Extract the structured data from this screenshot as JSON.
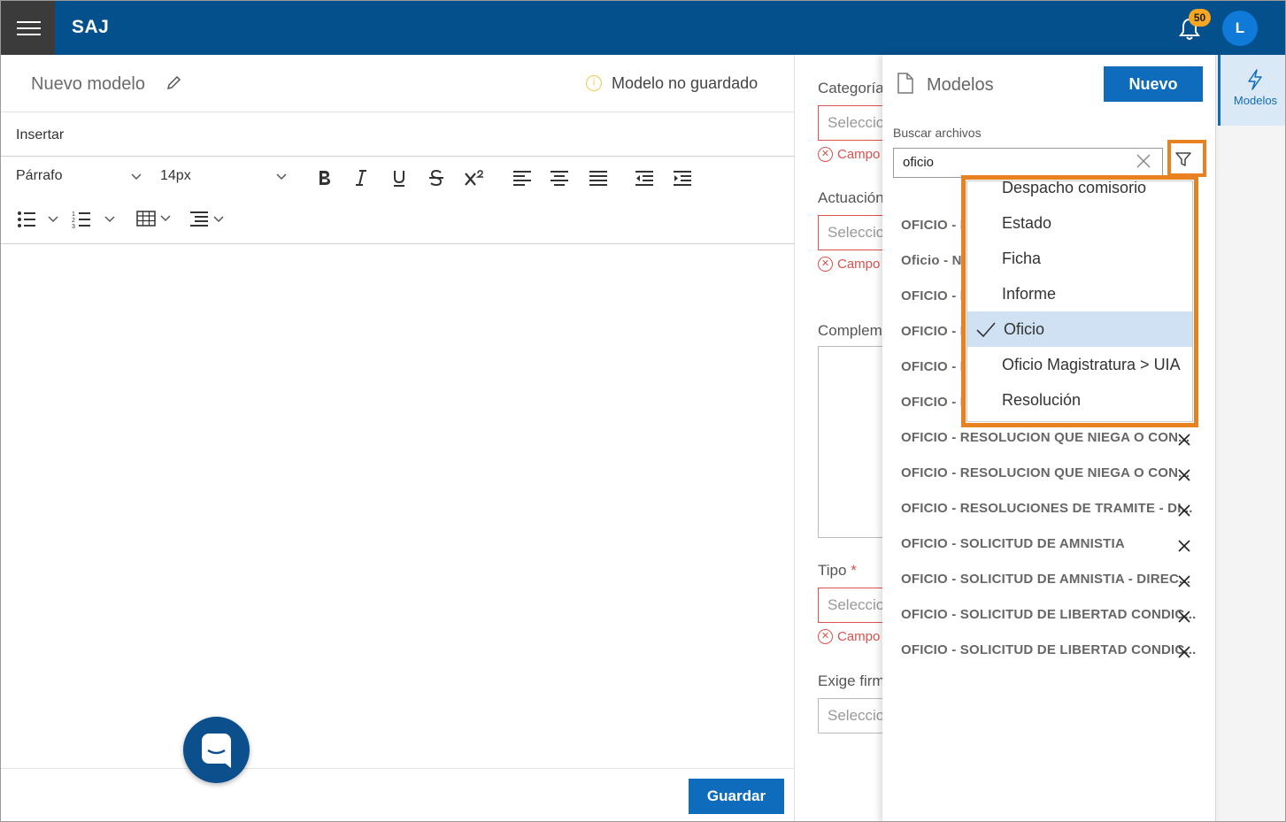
{
  "topbar": {
    "brand": "SAJ",
    "notifications_count": "50",
    "avatar_initial": "L"
  },
  "editor": {
    "title": "Nuevo modelo",
    "status": "Modelo no guardado",
    "menu_insert": "Insertar",
    "paragraph_select": "Párrafo",
    "font_size_select": "14px",
    "save_label": "Guardar"
  },
  "form": {
    "categoria_label": "Categoría",
    "actuacion_label": "Actuación",
    "complemento_label": "Complem",
    "tipo_label": "Tipo",
    "exige_label": "Exige firm",
    "select_placeholder": "Seleccio",
    "error_text": "Campo"
  },
  "panel": {
    "title": "Modelos",
    "new_label": "Nuevo",
    "search_label": "Buscar archivos",
    "search_value": "oficio",
    "items": [
      "OFICIO - D",
      "Oficio - No",
      "OFICIO - F",
      "OFICIO - F",
      "OFICIO - F",
      "OFICIO - F",
      "OFICIO - RESOLUCION QUE NIEGA O CON...",
      "OFICIO - RESOLUCION QUE NIEGA O CON...",
      "OFICIO - RESOLUCIONES DE TRAMITE - DI...",
      "OFICIO - SOLICITUD DE AMNISTIA",
      "OFICIO - SOLICITUD DE AMNISTIA - DIREC...",
      "OFICIO - SOLICITUD DE LIBERTAD CONDIC...",
      "OFICIO - SOLICITUD DE LIBERTAD CONDIC..."
    ]
  },
  "filter_dropdown": {
    "options": [
      "Despacho comisorio",
      "Estado",
      "Ficha",
      "Informe",
      "Oficio",
      "Oficio Magistratura > UIA",
      "Resolución"
    ],
    "selected": "Oficio"
  },
  "rail": {
    "modelos_label": "Modelos"
  },
  "colors": {
    "primary": "#03508c",
    "button": "#0f6cbd",
    "highlight": "#e8811f",
    "error": "#d9534f"
  }
}
